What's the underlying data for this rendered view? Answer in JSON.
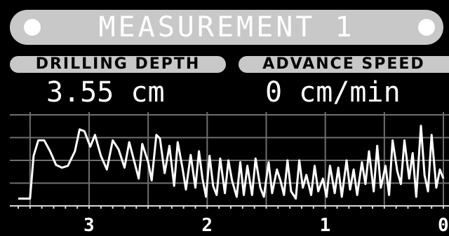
{
  "header": {
    "title": "MEASUREMENT 1"
  },
  "depth": {
    "label": "DRILLING DEPTH",
    "value": "3.55 cm"
  },
  "speed": {
    "label": "ADVANCE SPEED",
    "value": "0 cm/min"
  },
  "chart_data": {
    "type": "line",
    "title": "",
    "xlabel": "",
    "ylabel": "",
    "x_tick_labels": [
      "3",
      "2",
      "1",
      "0"
    ],
    "x_ticks": [
      3,
      2,
      1,
      0
    ],
    "xlim": [
      3.6,
      0.0
    ],
    "ylim": [
      0,
      1
    ],
    "grid": true,
    "series": [
      {
        "x": [
          3.6,
          3.56,
          3.5,
          3.47,
          3.43,
          3.38,
          3.33,
          3.28,
          3.23,
          3.18,
          3.12,
          3.08,
          3.04,
          2.99,
          2.95,
          2.9,
          2.85,
          2.8,
          2.75,
          2.7,
          2.66,
          2.62,
          2.58,
          2.55,
          2.5,
          2.47,
          2.43,
          2.4,
          2.36,
          2.32,
          2.28,
          2.25,
          2.21,
          2.18,
          2.14,
          2.1,
          2.07,
          2.04,
          2.01,
          1.98,
          1.95,
          1.92,
          1.89,
          1.85,
          1.82,
          1.79,
          1.75,
          1.72,
          1.69,
          1.66,
          1.62,
          1.59,
          1.55,
          1.52,
          1.48,
          1.45,
          1.41,
          1.38,
          1.35,
          1.32,
          1.29,
          1.25,
          1.22,
          1.19,
          1.16,
          1.12,
          1.09,
          1.06,
          1.02,
          0.99,
          0.96,
          0.92,
          0.89,
          0.86,
          0.82,
          0.79,
          0.76,
          0.73,
          0.69,
          0.66,
          0.63,
          0.59,
          0.56,
          0.53,
          0.49,
          0.46,
          0.43,
          0.39,
          0.36,
          0.33,
          0.29,
          0.26,
          0.23,
          0.19,
          0.16,
          0.13,
          0.1,
          0.06,
          0.03,
          0.0
        ],
        "values": [
          0.08,
          0.08,
          0.08,
          0.55,
          0.72,
          0.72,
          0.6,
          0.45,
          0.42,
          0.44,
          0.6,
          0.84,
          0.82,
          0.65,
          0.78,
          0.55,
          0.4,
          0.72,
          0.62,
          0.42,
          0.7,
          0.5,
          0.3,
          0.68,
          0.48,
          0.28,
          0.78,
          0.74,
          0.36,
          0.66,
          0.22,
          0.7,
          0.42,
          0.18,
          0.56,
          0.2,
          0.6,
          0.3,
          0.1,
          0.55,
          0.22,
          0.12,
          0.52,
          0.14,
          0.5,
          0.28,
          0.1,
          0.48,
          0.12,
          0.44,
          0.12,
          0.52,
          0.2,
          0.1,
          0.48,
          0.14,
          0.4,
          0.28,
          0.12,
          0.5,
          0.16,
          0.08,
          0.5,
          0.2,
          0.34,
          0.12,
          0.44,
          0.16,
          0.3,
          0.1,
          0.44,
          0.14,
          0.42,
          0.1,
          0.5,
          0.18,
          0.4,
          0.12,
          0.48,
          0.24,
          0.6,
          0.16,
          0.66,
          0.2,
          0.44,
          0.12,
          0.72,
          0.38,
          0.24,
          0.72,
          0.3,
          0.58,
          0.1,
          0.88,
          0.34,
          0.16,
          0.78,
          0.2,
          0.4,
          0.3
        ]
      }
    ]
  }
}
